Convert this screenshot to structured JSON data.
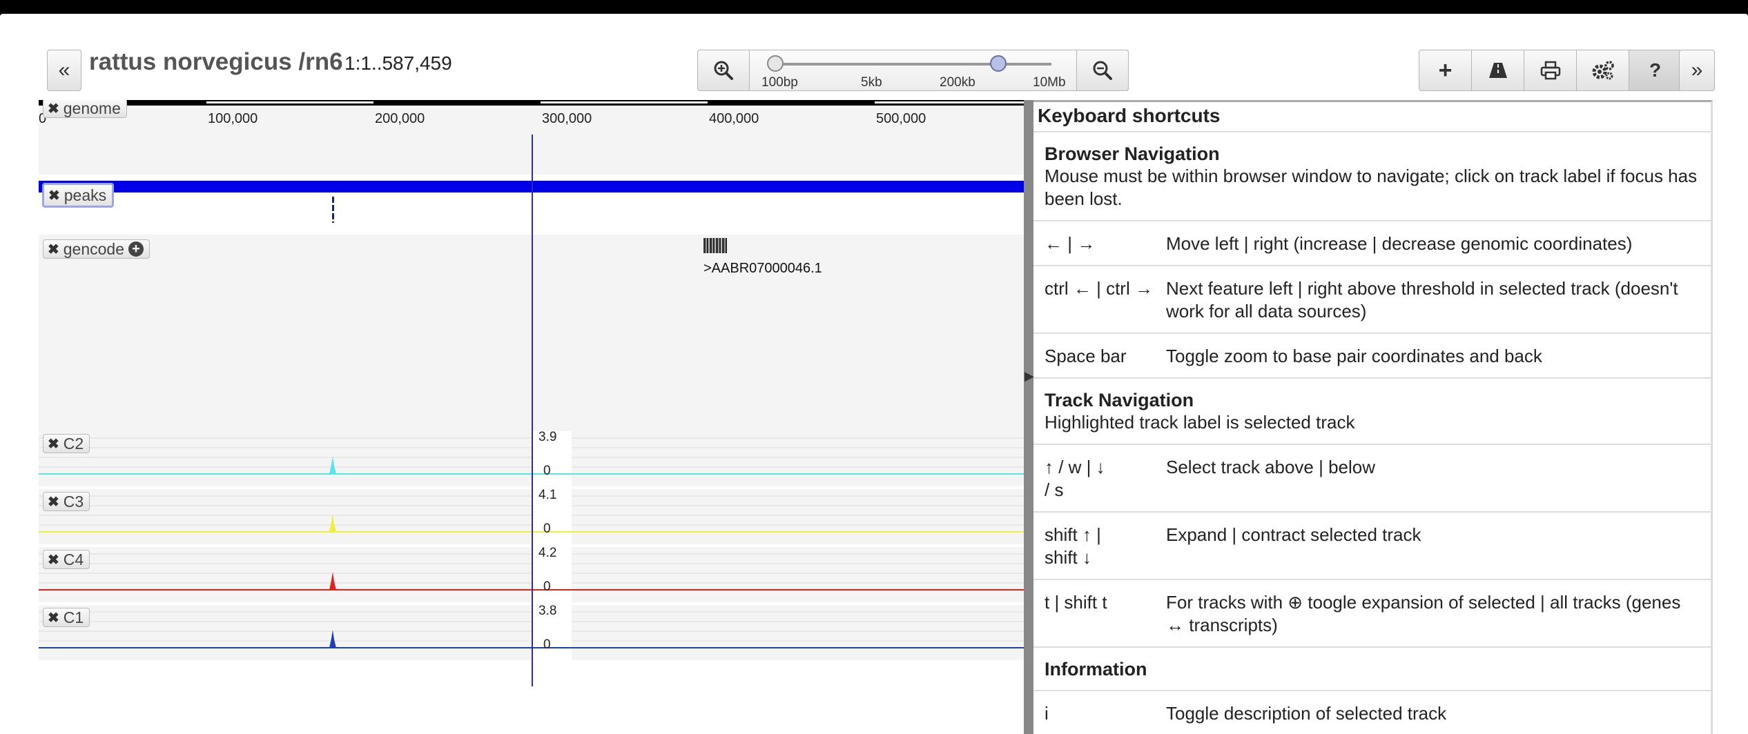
{
  "header": {
    "collapse_left": "«",
    "collapse_right": "»",
    "title": "rattus norvegicus /rn6",
    "location": "1:1..587,459"
  },
  "zoom": {
    "labels": [
      "100bp",
      "5kb",
      "200kb",
      "10Mb"
    ]
  },
  "toolbar": {
    "add": "+",
    "print_icon": "printer-icon",
    "settings_icon": "gears-icon",
    "help": "?"
  },
  "ruler": {
    "ticks": [
      "0",
      "100,000",
      "200,000",
      "300,000",
      "400,000",
      "500,000"
    ]
  },
  "tracks": {
    "genome": "genome",
    "peaks": "peaks",
    "gencode": "gencode",
    "gencode_feature": ">AABR07000046.1",
    "c2": {
      "label": "C2",
      "max": "3.9",
      "min": "0",
      "color": "#55e6ee"
    },
    "c3": {
      "label": "C3",
      "max": "4.1",
      "min": "0",
      "color": "#f2ef3a"
    },
    "c4": {
      "label": "C4",
      "max": "4.2",
      "min": "0",
      "color": "#e0231c"
    },
    "c1": {
      "label": "C1",
      "max": "3.8",
      "min": "0",
      "color": "#1c3fb8"
    }
  },
  "shortcuts": {
    "title": "Keyboard shortcuts",
    "browser_nav": {
      "title": "Browser Navigation",
      "text": "Mouse must be within browser window to navigate; click on track label if focus has been lost."
    },
    "rows1": [
      {
        "key": "← | →",
        "desc": "Move left | right (increase | decrease genomic coordinates)"
      },
      {
        "key": "ctrl ← | ctrl →",
        "desc": "Next feature left | right above threshold in selected track (doesn't work for all data sources)"
      },
      {
        "key": "Space bar",
        "desc": "Toggle zoom to base pair coordinates and back"
      }
    ],
    "track_nav": {
      "title": "Track Navigation",
      "text": "Highlighted track label is selected track"
    },
    "rows2": [
      {
        "key": "↑ / w | ↓ / s",
        "desc": "Select track above | below"
      },
      {
        "key": "shift ↑ | shift ↓",
        "desc": "Expand | contract selected track"
      },
      {
        "key": "t | shift t",
        "desc": "For tracks with ⊕ toogle expansion of selected | all tracks (genes ↔ transcripts)"
      }
    ],
    "information": {
      "title": "Information"
    },
    "rows3": [
      {
        "key": "i",
        "desc": "Toggle description of selected track"
      }
    ]
  }
}
